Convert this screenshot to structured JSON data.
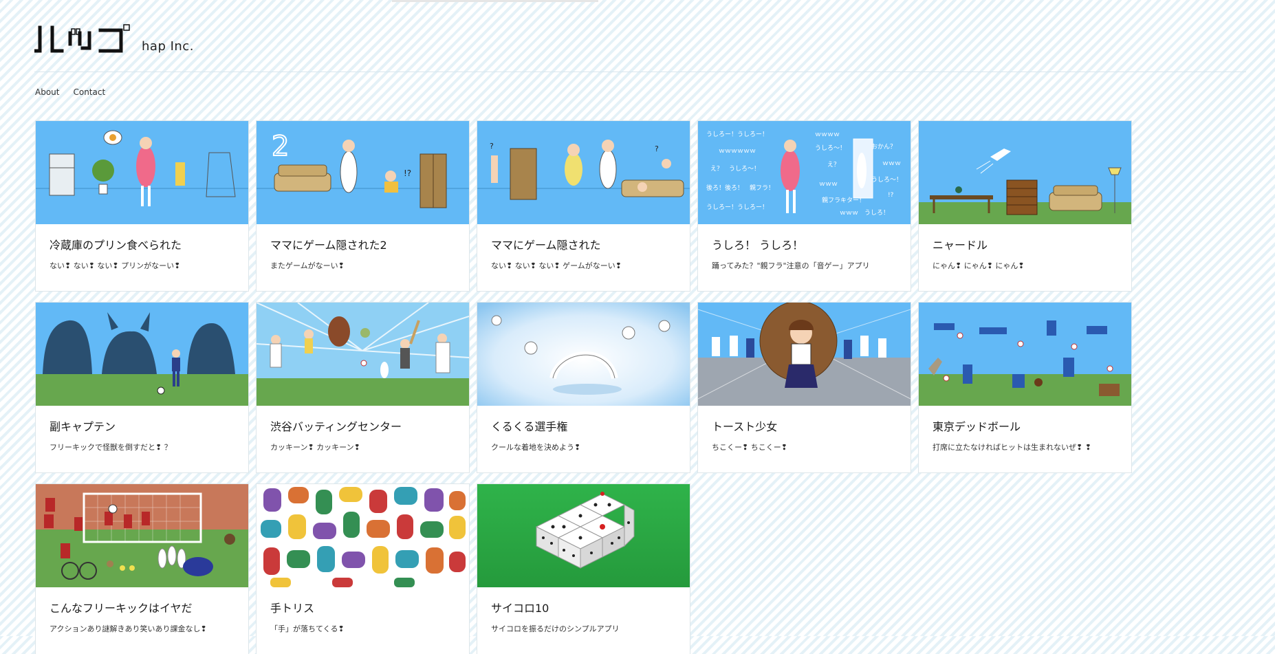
{
  "header": {
    "logo_sub": "hap Inc."
  },
  "nav": {
    "about": "About",
    "contact": "Contact"
  },
  "colors": {
    "sky": "#62b9f6",
    "grass": "#67a74e",
    "card_bg": "#ffffff"
  },
  "apps": [
    {
      "title": "冷蔵庫のプリン食べられた",
      "desc": "ない❢ ない❢ ない❢ プリンがなーい❢"
    },
    {
      "title": "ママにゲーム隠された2",
      "desc": "またゲームがなーい❢"
    },
    {
      "title": "ママにゲーム隠された",
      "desc": "ない❢ ない❢ ない❢ ゲームがなーい❢"
    },
    {
      "title": "うしろ！ うしろ！",
      "desc": "踊ってみた？\"親フラ\"注意の「音ゲー」アプリ"
    },
    {
      "title": "ニャードル",
      "desc": "にゃん❢ にゃん❢ にゃん❢"
    },
    {
      "title": "副キャプテン",
      "desc": "フリーキックで怪獣を倒すだと❢ ？"
    },
    {
      "title": "渋谷バッティングセンター",
      "desc": "カッキーン❢ カッキーン❢"
    },
    {
      "title": "くるくる選手権",
      "desc": "クールな着地を決めよう❢"
    },
    {
      "title": "トースト少女",
      "desc": "ちこくー❢ ちこくー❢"
    },
    {
      "title": "東京デッドボール",
      "desc": "打席に立たなければヒットは生まれないぜ❢ ❢"
    },
    {
      "title": "こんなフリーキックはイヤだ",
      "desc": "アクションあり謎解きあり笑いあり課金なし❢"
    },
    {
      "title": "手トリス",
      "desc": "「手」が落ちてくる❢"
    },
    {
      "title": "サイコロ10",
      "desc": "サイコロを振るだけのシンプルアプリ"
    }
  ],
  "thumb_text": {
    "two": "2",
    "ushiro_1": "うしろー！うしろー！",
    "ushiro_2": "ｗｗｗｗ",
    "ushiro_3": "ｗｗｗｗｗｗ",
    "ushiro_4": "うしろ〜！",
    "ushiro_5": "おかん？",
    "ushiro_6": "え？　うしろ〜！",
    "ushiro_7": "ｗｗｗ",
    "ushiro_8": "え？",
    "ushiro_9": "後ろ！後ろ！　親フラ！",
    "ushiro_10": "うしろ〜！",
    "ushiro_11": "ｗｗｗ",
    "ushiro_12": "!?",
    "ushiro_13": "親フラキター！",
    "ushiro_14": "うしろー！うしろー！",
    "ushiro_15": "ｗｗｗ　うしろ！",
    "qmark": "?",
    "excl": "!?"
  }
}
